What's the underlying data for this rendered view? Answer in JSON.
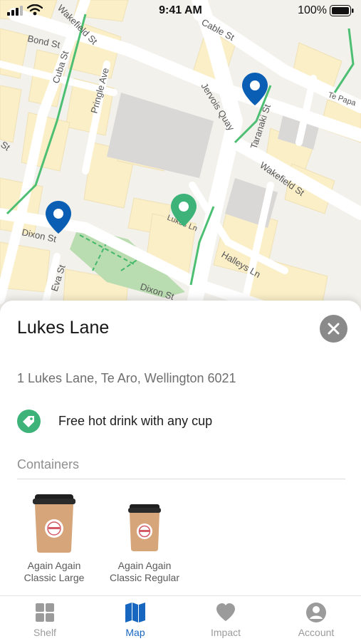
{
  "status_bar": {
    "time": "9:41 AM",
    "battery": "100%"
  },
  "map": {
    "streets": [
      "Bond St",
      "Wakefield St",
      "Cuba St",
      "Pringle Ave",
      "Cable St",
      "Te Papa",
      "Jervois Quay",
      "Taranaki St",
      "Wakefield St",
      "Lukes Ln",
      "Dixon St",
      "Eva St",
      "Dixon St",
      "Halleys Ln",
      "St"
    ],
    "pins": [
      {
        "name": "blue-pin-cable-st",
        "color": "#0a5fb4"
      },
      {
        "name": "blue-pin-dixon-st",
        "color": "#0a5fb4"
      },
      {
        "name": "green-pin-lukes-ln",
        "color": "#3db37a"
      }
    ]
  },
  "place": {
    "title": "Lukes Lane",
    "address": "1 Lukes Lane, Te Aro, Wellington 6021",
    "offer": "Free hot drink with any cup",
    "containers_label": "Containers",
    "containers": [
      {
        "name": "Again Again Classic Large",
        "line1": "Again Again",
        "line2": "Classic Large"
      },
      {
        "name": "Again Again Classic Regular",
        "line1": "Again Again",
        "line2": "Classic Regular"
      }
    ]
  },
  "tabs": [
    {
      "label": "Shelf",
      "icon": "grid-icon"
    },
    {
      "label": "Map",
      "icon": "map-icon",
      "active": true
    },
    {
      "label": "Impact",
      "icon": "heart-icon"
    },
    {
      "label": "Account",
      "icon": "person-icon"
    }
  ],
  "colors": {
    "accent_blue": "#1767c1",
    "pin_blue": "#0a5fb4",
    "pin_green": "#3db37a",
    "close_gray": "#8a8a8a"
  }
}
